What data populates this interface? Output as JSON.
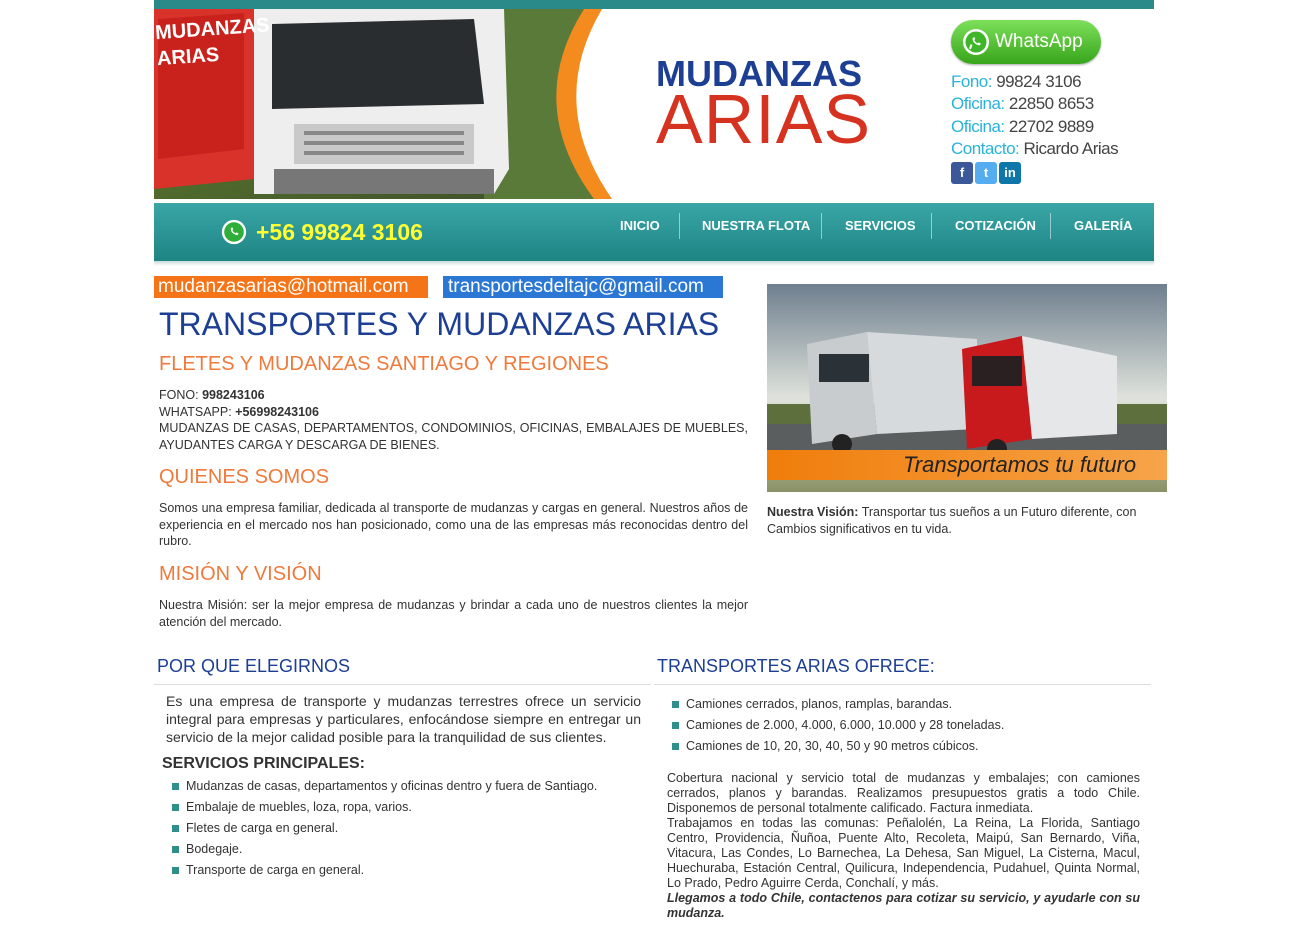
{
  "header": {
    "truck_brand_text": "MUDANZAS ARIAS",
    "logo_line1": "MUDANZAS",
    "logo_line2": "ARIAS",
    "whatsapp_button": "WhatsApp",
    "contacts": [
      {
        "label": "Fono:",
        "value": " 99824 3106"
      },
      {
        "label": "Oficina:",
        "value": " 22850 8653"
      },
      {
        "label": "Oficina:",
        "value": " 22702 9889"
      },
      {
        "label": "Contacto:",
        "value": " Ricardo Arias"
      }
    ],
    "social": [
      "f",
      "t",
      "in"
    ]
  },
  "nav": {
    "phone": "+56 99824 3106",
    "items": [
      "INICIO",
      "NUESTRA FLOTA",
      "SERVICIOS",
      "COTIZACIÓN",
      "GALERÍA"
    ]
  },
  "emails": [
    "mudanzasarias@hotmail.com",
    "transportesdeltajc@gmail.com"
  ],
  "main": {
    "title": "TRANSPORTES Y MUDANZAS ARIAS",
    "subtitle": "FLETES Y MUDANZAS SANTIAGO Y REGIONES",
    "fono_label": "FONO: ",
    "fono_value": "998243106",
    "whatsapp_label": "WHATSAPP: ",
    "whatsapp_value": "+56998243106",
    "services_line": "MUDANZAS DE CASAS, DEPARTAMENTOS, CONDOMINIOS, OFICINAS, EMBALAJES DE MUEBLES, AYUDANTES CARGA Y DESCARGA DE BIENES.",
    "quienes_title": "QUIENES SOMOS",
    "quienes_text": "Somos una empresa familiar, dedicada al transporte de mudanzas y cargas en general. Nuestros años de experiencia en el mercado nos han posicionado, como una de las empresas más reconocidas dentro del rubro.",
    "mision_title": "MISIÓN Y VISIÓN",
    "mision_text": "Nuestra Misión: ser la mejor empresa de mudanzas  y brindar a cada uno de nuestros clientes la mejor atención del mercado."
  },
  "right": {
    "banner_text": "Transportamos tu futuro",
    "vision_label": "Nuestra Visión:",
    "vision_text": " Transportar tus sueños a un Futuro diferente, con Cambios significativos en tu vida."
  },
  "por_que": {
    "title": "POR QUE ELEGIRNOS",
    "text": "Es una empresa de transporte y mudanzas terrestres ofrece un servicio integral para empresas y particulares, enfocándose siempre en entregar un servicio de la mejor calidad posible para la tranquilidad de sus clientes.",
    "services_title": "SERVICIOS PRINCIPALES:",
    "services": [
      "Mudanzas de casas, departamentos y oficinas dentro y fuera de Santiago.",
      "Embalaje de muebles, loza, ropa, varios.",
      "Fletes de carga en general.",
      "Bodegaje.",
      "Transporte de carga en general."
    ]
  },
  "ofrece": {
    "title": "TRANSPORTES ARIAS OFRECE:",
    "items": [
      "Camiones cerrados, planos, ramplas, barandas.",
      "Camiones de 2.000, 4.000, 6.000, 10.000 y 28 toneladas.",
      "Camiones de 10, 20, 30, 40, 50 y 90 metros cúbicos."
    ],
    "paragraph1": "Cobertura nacional y servicio total de mudanzas y embalajes; con camiones cerrados, planos y barandas. Realizamos presupuestos gratis a todo Chile. Disponemos de personal totalmente calificado. Factura inmediata.",
    "paragraph2": "Trabajamos en todas las comunas: Peñalolén, La Reina, La Florida, Santiago Centro, Providencia, Ñuñoa, Puente Alto, Recoleta, Maipú, San Bernardo, Viña, Vitacura, Las Condes, Lo Barnechea, La Dehesa, San Miguel, La Cisterna, Macul, Huechuraba, Estación Central, Quilicura, Independencia, Pudahuel, Quinta Normal, Lo Prado, Pedro Aguirre Cerda, Conchalí, y más.",
    "closing": "Llegamos a todo Chile, contactenos para cotizar su servicio, y ayudarle con su mudanza."
  }
}
